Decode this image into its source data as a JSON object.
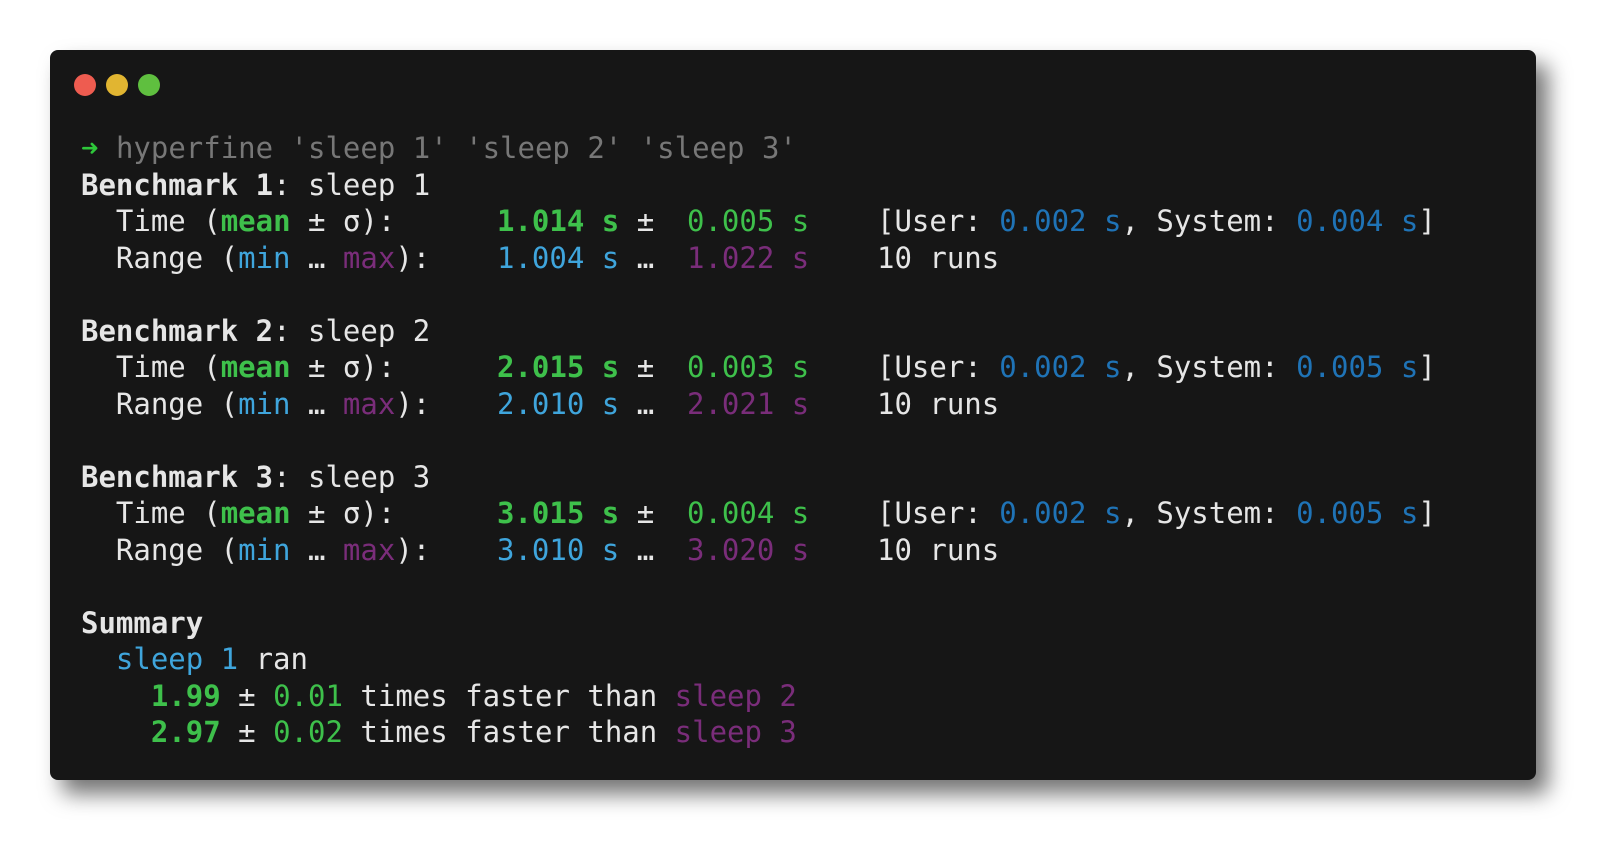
{
  "window": {
    "buttons": [
      "close",
      "minimize",
      "maximize"
    ]
  },
  "prompt": {
    "arrow": "➜",
    "command": "hyperfine 'sleep 1' 'sleep 2' 'sleep 3'"
  },
  "labels": {
    "time_prefix": "Time (",
    "mean": "mean",
    "time_suffix": " ± σ):",
    "range_prefix": "Range (",
    "min": "min",
    "ellipsis": " … ",
    "max": "max",
    "range_suffix": "):",
    "pm": "±",
    "range_sep": "…",
    "user_prefix": "[User: ",
    "system_prefix": ", System: ",
    "close_bracket": "]",
    "summary": "Summary",
    "ran": " ran",
    "times_faster_than": " times faster than "
  },
  "benchmarks": [
    {
      "header": "Benchmark 1",
      "name": "sleep 1",
      "mean": "1.014 s",
      "sigma": "0.005 s",
      "user_val": "0.002",
      "user_unit": "s",
      "system_val": "0.004",
      "system_unit": "s",
      "min": "1.004 s",
      "max": "1.022 s",
      "runs": "10 runs"
    },
    {
      "header": "Benchmark 2",
      "name": "sleep 2",
      "mean": "2.015 s",
      "sigma": "0.003 s",
      "user_val": "0.002",
      "user_unit": "s",
      "system_val": "0.005",
      "system_unit": "s",
      "min": "2.010 s",
      "max": "2.021 s",
      "runs": "10 runs"
    },
    {
      "header": "Benchmark 3",
      "name": "sleep 3",
      "mean": "3.015 s",
      "sigma": "0.004 s",
      "user_val": "0.002",
      "user_unit": "s",
      "system_val": "0.005",
      "system_unit": "s",
      "min": "3.010 s",
      "max": "3.020 s",
      "runs": "10 runs"
    }
  ],
  "summary": {
    "fastest": "sleep 1",
    "comparisons": [
      {
        "ratio": "1.99",
        "pm": "±",
        "err": "0.01",
        "other": "sleep 2"
      },
      {
        "ratio": "2.97",
        "pm": "±",
        "err": "0.02",
        "other": "sleep 3"
      }
    ]
  },
  "colors": {
    "background": "#161616",
    "text": "#e6e6e6",
    "green": "#3ec04b",
    "cyan": "#3fa5dc",
    "blue": "#1f73b6",
    "magenta": "#7a2d7a",
    "command": "#777777",
    "close_button": "#ee5c50",
    "minimize_button": "#e1b531",
    "maximize_button": "#5fbf3f"
  }
}
